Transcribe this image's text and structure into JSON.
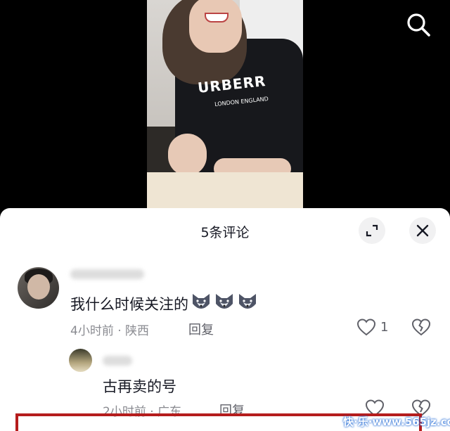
{
  "video": {
    "shirt_text": "URBERR",
    "shirt_subtext": "LONDON ENGLAND"
  },
  "top_bar": {
    "search_icon": "search-icon"
  },
  "comments_sheet": {
    "title": "5条评论",
    "expand_icon": "expand-icon",
    "close_icon": "close-icon"
  },
  "comments": [
    {
      "text": "我什么时候关注的",
      "emojis": [
        "wolf-emoji",
        "wolf-emoji",
        "wolf-emoji"
      ],
      "meta": "4小时前 · 陕西",
      "reply_label": "回复",
      "likes": "1"
    },
    {
      "text": "古再卖的号",
      "meta": "2小时前 · 广东",
      "reply_label": "回复"
    }
  ],
  "watermark": "快·乐·www.565jz.com",
  "colors": {
    "highlight_box": "#b51d1d",
    "text": "#161823",
    "meta": "#8a8b91"
  }
}
